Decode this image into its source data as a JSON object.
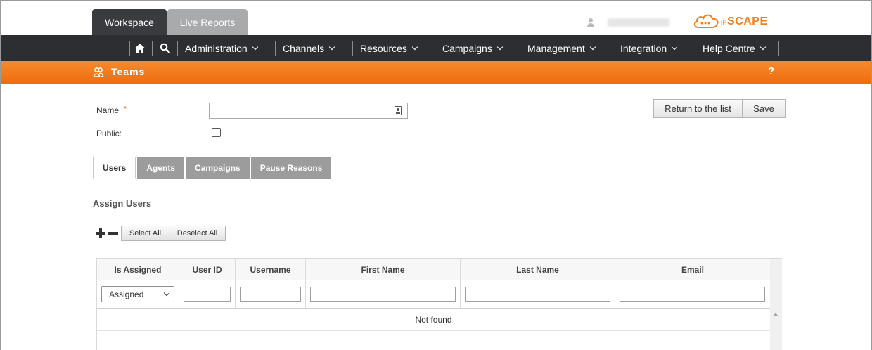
{
  "top_tabs": [
    {
      "label": "Workspace",
      "active": true
    },
    {
      "label": "Live Reports",
      "active": false
    }
  ],
  "user": {
    "name": "ipscape_user"
  },
  "logo": {
    "prefix": "iP",
    "main": "SCAPE",
    "color": "#f07e1d"
  },
  "nav": {
    "home_icon": "home-icon",
    "search_icon": "search-icon",
    "items": [
      {
        "label": "Administration"
      },
      {
        "label": "Channels"
      },
      {
        "label": "Resources"
      },
      {
        "label": "Campaigns"
      },
      {
        "label": "Management"
      },
      {
        "label": "Integration"
      },
      {
        "label": "Help Centre"
      }
    ]
  },
  "page": {
    "title": "Teams",
    "help_label": "?",
    "accent": "#f07e1d"
  },
  "form": {
    "name_label": "Name",
    "required_mark": "*",
    "name_value": "",
    "public_label": "Public:",
    "public_checked": false
  },
  "actions": {
    "return_label": "Return to the list",
    "save_label": "Save"
  },
  "tabs": [
    {
      "label": "Users",
      "active": true
    },
    {
      "label": "Agents",
      "active": false
    },
    {
      "label": "Campaigns",
      "active": false
    },
    {
      "label": "Pause Reasons",
      "active": false
    }
  ],
  "assign": {
    "title": "Assign Users",
    "select_all_label": "Select All",
    "deselect_all_label": "Deselect All"
  },
  "grid": {
    "columns": [
      "Is Assigned",
      "User ID",
      "Username",
      "First Name",
      "Last Name",
      "Email"
    ],
    "filter_assigned_value": "Assigned",
    "empty_text": "Not found"
  }
}
